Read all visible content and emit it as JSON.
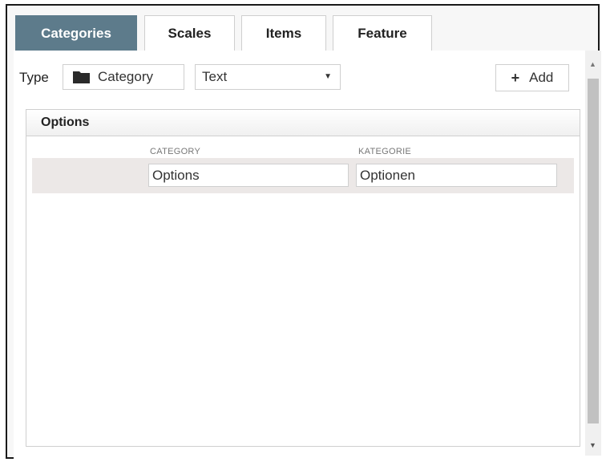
{
  "tabs": [
    {
      "label": "Categories",
      "active": true
    },
    {
      "label": "Scales",
      "active": false
    },
    {
      "label": "Items",
      "active": false
    },
    {
      "label": "Feature",
      "active": false
    }
  ],
  "toolbar": {
    "type_label": "Type",
    "category_button": "Category",
    "select_value": "Text",
    "select_arrow": "▼",
    "add_label": "Add",
    "add_icon": "+"
  },
  "list": {
    "header": "Options",
    "columns": [
      "CATEGORY",
      "KATEGORIE"
    ],
    "rows": [
      {
        "category": "Options",
        "kategorie": "Optionen"
      }
    ]
  },
  "scrollbar": {
    "up": "▲",
    "down": "▼"
  },
  "colors": {
    "active_tab": "#5d7b8b",
    "row_bg": "#ece8e7"
  }
}
